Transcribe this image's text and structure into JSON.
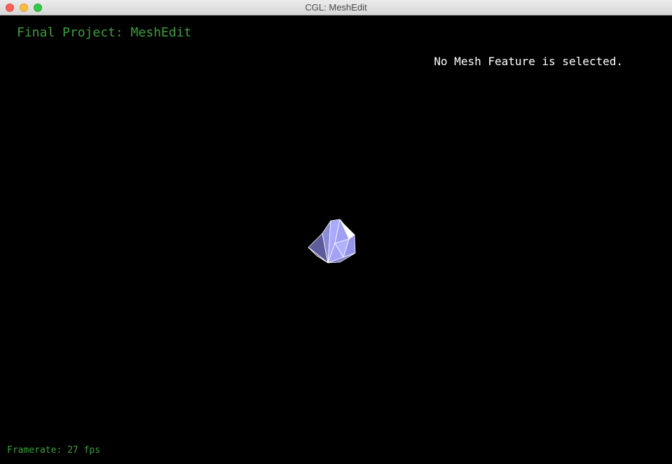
{
  "window": {
    "title": "CGL: MeshEdit"
  },
  "viewport": {
    "project_title": "Final Project: MeshEdit",
    "selection_status": "No Mesh Feature is selected.",
    "framerate": "Framerate: 27 fps",
    "mesh": "mesh-model",
    "colors": {
      "background": "#000000",
      "overlay_green": "#3aa03a",
      "mesh_fill": "#a8a8ff",
      "mesh_edge": "#ffffff"
    }
  }
}
